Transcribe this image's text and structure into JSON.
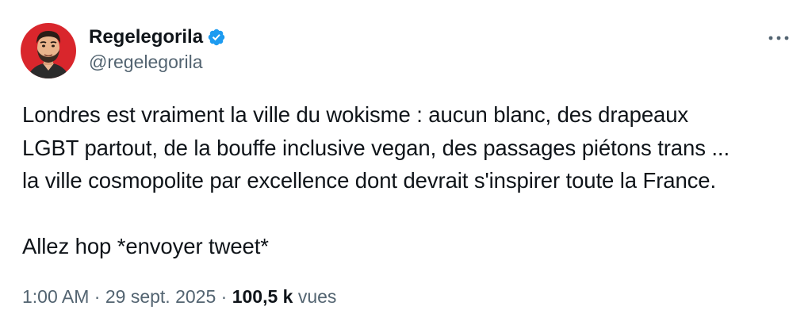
{
  "author": {
    "display_name": "Regelegorila",
    "handle": "@regelegorila",
    "verified": true,
    "verified_color": "#1d9bf0",
    "avatar_bg": "#d9262c"
  },
  "tweet": {
    "lines": [
      "Londres est vraiment la ville du wokisme : aucun blanc, des drapeaux",
      "LGBT partout, de la bouffe inclusive vegan, des passages piétons trans ...",
      "la ville cosmopolite par excellence dont devrait s'inspirer toute la France.",
      "Allez hop *envoyer tweet*"
    ]
  },
  "meta": {
    "time": "1:00 AM",
    "separator": "·",
    "date": "29 sept. 2025",
    "views_count": "100,5 k",
    "views_label": "vues"
  },
  "icons": {
    "more": "more-icon",
    "verified": "verified-badge-icon"
  }
}
